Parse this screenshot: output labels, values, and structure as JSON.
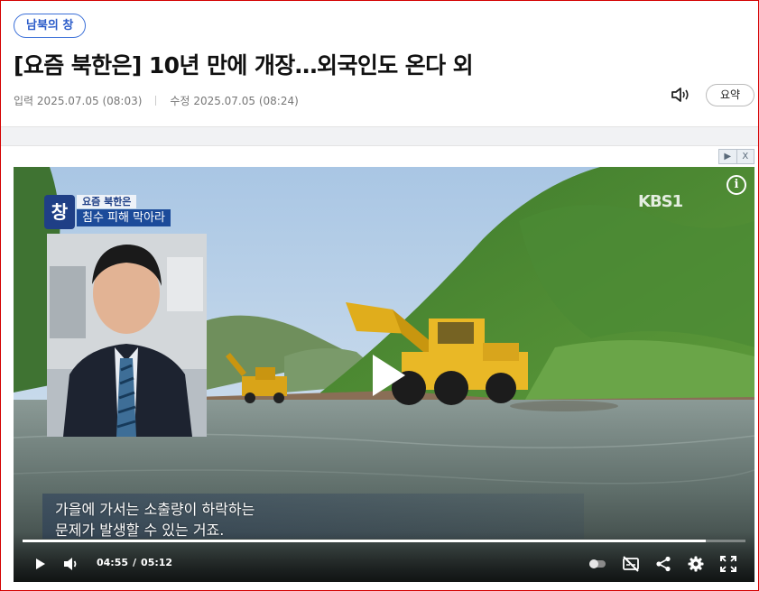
{
  "article": {
    "section_badge": "남북의 창",
    "title": "[요즘 북한은] 10년 만에 개장…외국인도 온다 외",
    "published_label": "입력",
    "published_time": "2025.07.05 (08:03)",
    "modified_label": "수정",
    "modified_time": "2025.07.05 (08:24)",
    "summary_button": "요약"
  },
  "ad": {
    "play_symbol": "▶",
    "close_symbol": "X"
  },
  "video": {
    "channel_logo": "KBS1",
    "program_logo": "창",
    "segment_tag": "요즘 북한은",
    "segment_title": "침수 피해 막아라",
    "subtitle_line1": "가을에 가서는 소출량이 하락하는",
    "subtitle_line2": "문제가 발생할 수 있는 거죠.",
    "current_time": "04:55",
    "duration": "05:12",
    "progress_fraction": 0.945,
    "info_symbol": "i"
  },
  "icons": {
    "speaker": "speaker-icon",
    "play": "play-icon",
    "volume": "volume-icon",
    "autoplay": "autoplay-toggle-icon",
    "captions": "captions-off-icon",
    "share": "share-icon",
    "settings": "gear-icon",
    "fullscreen": "fullscreen-icon"
  },
  "colors": {
    "accent_blue": "#2a5bc9",
    "frame_border": "#d40000",
    "segment_tag_bg": "#1c4b9a"
  }
}
